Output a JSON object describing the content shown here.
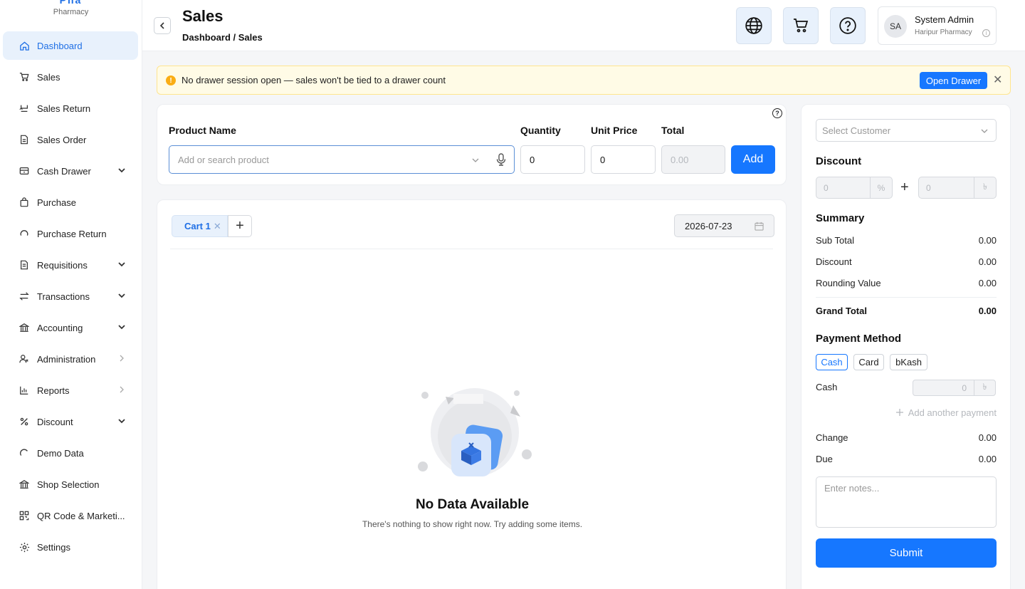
{
  "brand": {
    "logo_partial": "Pha",
    "subtitle": "Pharmacy"
  },
  "sidebar": {
    "items": [
      {
        "label": "Dashboard",
        "icon": "home-icon",
        "active": true,
        "expand": ""
      },
      {
        "label": "Sales",
        "icon": "cart-icon",
        "active": false,
        "expand": ""
      },
      {
        "label": "Sales Return",
        "icon": "return-icon",
        "active": false,
        "expand": ""
      },
      {
        "label": "Sales Order",
        "icon": "document-icon",
        "active": false,
        "expand": ""
      },
      {
        "label": "Cash Drawer",
        "icon": "drawer-icon",
        "active": false,
        "expand": "down"
      },
      {
        "label": "Purchase",
        "icon": "bag-icon",
        "active": false,
        "expand": ""
      },
      {
        "label": "Purchase Return",
        "icon": "undo-icon",
        "active": false,
        "expand": ""
      },
      {
        "label": "Requisitions",
        "icon": "file-icon",
        "active": false,
        "expand": "down"
      },
      {
        "label": "Transactions",
        "icon": "swap-icon",
        "active": false,
        "expand": "down"
      },
      {
        "label": "Accounting",
        "icon": "bank-icon",
        "active": false,
        "expand": "down"
      },
      {
        "label": "Administration",
        "icon": "users-icon",
        "active": false,
        "expand": "right"
      },
      {
        "label": "Reports",
        "icon": "bar-chart-icon",
        "active": false,
        "expand": "right"
      },
      {
        "label": "Discount",
        "icon": "percent-icon",
        "active": false,
        "expand": "down"
      },
      {
        "label": "Demo Data",
        "icon": "refresh-icon",
        "active": false,
        "expand": ""
      },
      {
        "label": "Shop Selection",
        "icon": "shop-icon",
        "active": false,
        "expand": ""
      },
      {
        "label": "QR Code & Marketi...",
        "icon": "qr-icon",
        "active": false,
        "expand": ""
      },
      {
        "label": "Settings",
        "icon": "gear-icon",
        "active": false,
        "expand": ""
      }
    ]
  },
  "header": {
    "title": "Sales",
    "breadcrumb": "Dashboard / Sales",
    "user": {
      "initials": "SA",
      "name": "System Admin",
      "shop": "Haripur Pharmacy"
    }
  },
  "alert": {
    "icon_glyph": "!",
    "text": "No drawer session open — sales won't be tied to a drawer count",
    "action": "Open Drawer",
    "close": "✕"
  },
  "product_form": {
    "help_glyph": "?",
    "product_label": "Product Name",
    "product_placeholder": "Add or search product",
    "quantity_label": "Quantity",
    "quantity_value": "0",
    "unit_price_label": "Unit Price",
    "unit_price_value": "0",
    "total_label": "Total",
    "total_value": "0.00",
    "add_label": "Add"
  },
  "cart": {
    "tab_label": "Cart 1",
    "tab_close": "✕",
    "add_tab": "+",
    "date": "2026-07-23",
    "empty_title": "No Data Available",
    "empty_subtitle": "There's nothing to show right now. Try adding some items."
  },
  "checkout": {
    "customer_placeholder": "Select Customer",
    "discount_heading": "Discount",
    "discount_percent_value": "0",
    "discount_percent_suffix": "%",
    "discount_plus": "+",
    "discount_amount_value": "0",
    "discount_amount_suffix": "৳",
    "summary_heading": "Summary",
    "sub_total_label": "Sub Total",
    "sub_total_value": "0.00",
    "discount_label": "Discount",
    "discount_value": "0.00",
    "rounding_label": "Rounding Value",
    "rounding_value": "0.00",
    "grand_total_label": "Grand Total",
    "grand_total_value": "0.00",
    "payment_heading": "Payment Method",
    "payment_methods": [
      "Cash",
      "Card",
      "bKash"
    ],
    "cash_label": "Cash",
    "cash_value": "0",
    "cash_suffix": "৳",
    "add_payment": "Add another payment",
    "change_label": "Change",
    "change_value": "0.00",
    "due_label": "Due",
    "due_value": "0.00",
    "notes_placeholder": "Enter notes...",
    "submit_label": "Submit"
  },
  "colors": {
    "accent": "#1677ff",
    "active_bg": "#e8f1fc",
    "warning_bg": "#fffbe6",
    "warning_icon": "#faad14"
  }
}
